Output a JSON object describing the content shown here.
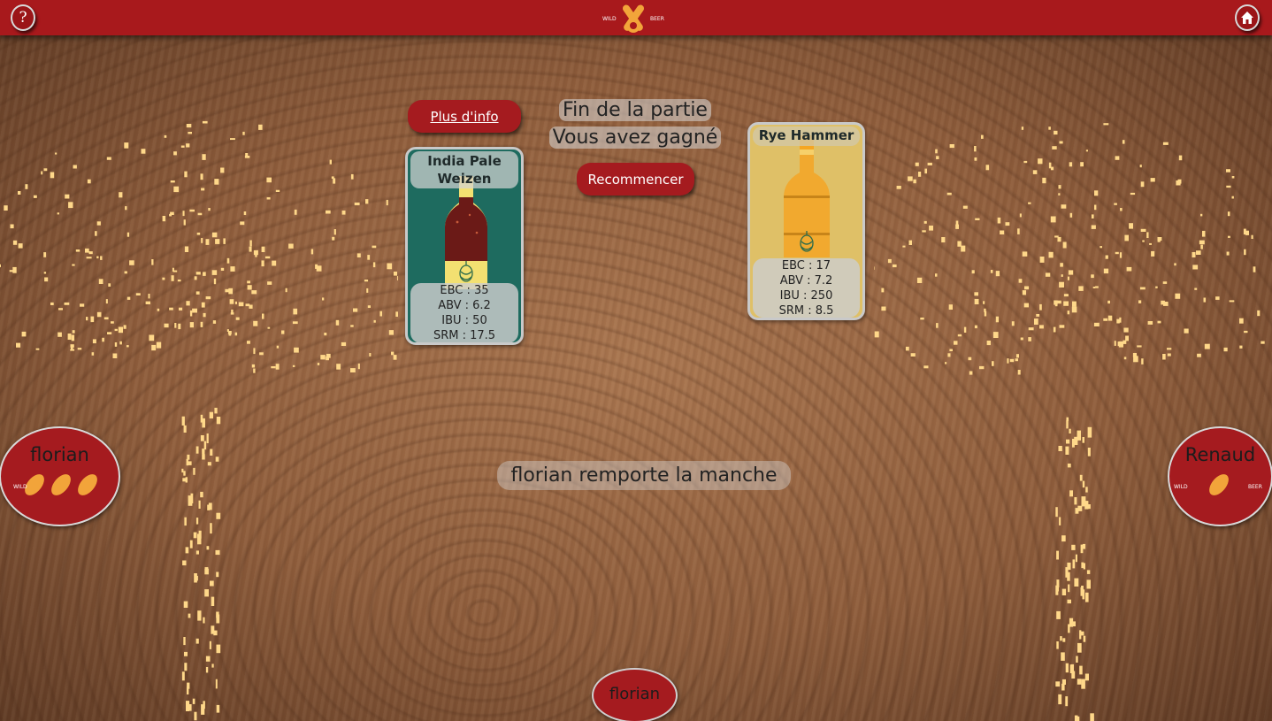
{
  "topbar": {
    "help_icon": "?",
    "logo_left": "WILD",
    "logo_right": "BEER"
  },
  "game": {
    "more_info": "Plus d'info",
    "status_line1": "Fin de la partie",
    "status_line2": "Vous avez gagné",
    "restart": "Recommencer",
    "round_result": "florian remporte la manche"
  },
  "cards": {
    "left": {
      "name": "India Pale Weizen",
      "ebc": "EBC : 35",
      "abv": "ABV : 6.2",
      "ibu": "IBU : 50",
      "srm": "SRM : 17.5",
      "bg_color": "#1e6b5f",
      "beer_color": "#6b1a17"
    },
    "right": {
      "name": "Rye Hammer",
      "ebc": "EBC : 17",
      "abv": "ABV : 7.2",
      "ibu": "IBU : 250",
      "srm": "SRM : 8.5",
      "bg_color": "#dfc067",
      "beer_color": "#f0a52a"
    }
  },
  "players": {
    "left": {
      "name": "florian"
    },
    "right": {
      "name": "Renaud"
    },
    "bottom": {
      "name": "florian"
    }
  },
  "colors": {
    "accent": "#a8191c",
    "confetti": "#ffd88a"
  },
  "icons": {
    "help": "question-icon",
    "home": "home-icon",
    "logo": "wild-beer-logo-icon",
    "hop": "hop-icon",
    "peanut": "peanut-icon"
  }
}
